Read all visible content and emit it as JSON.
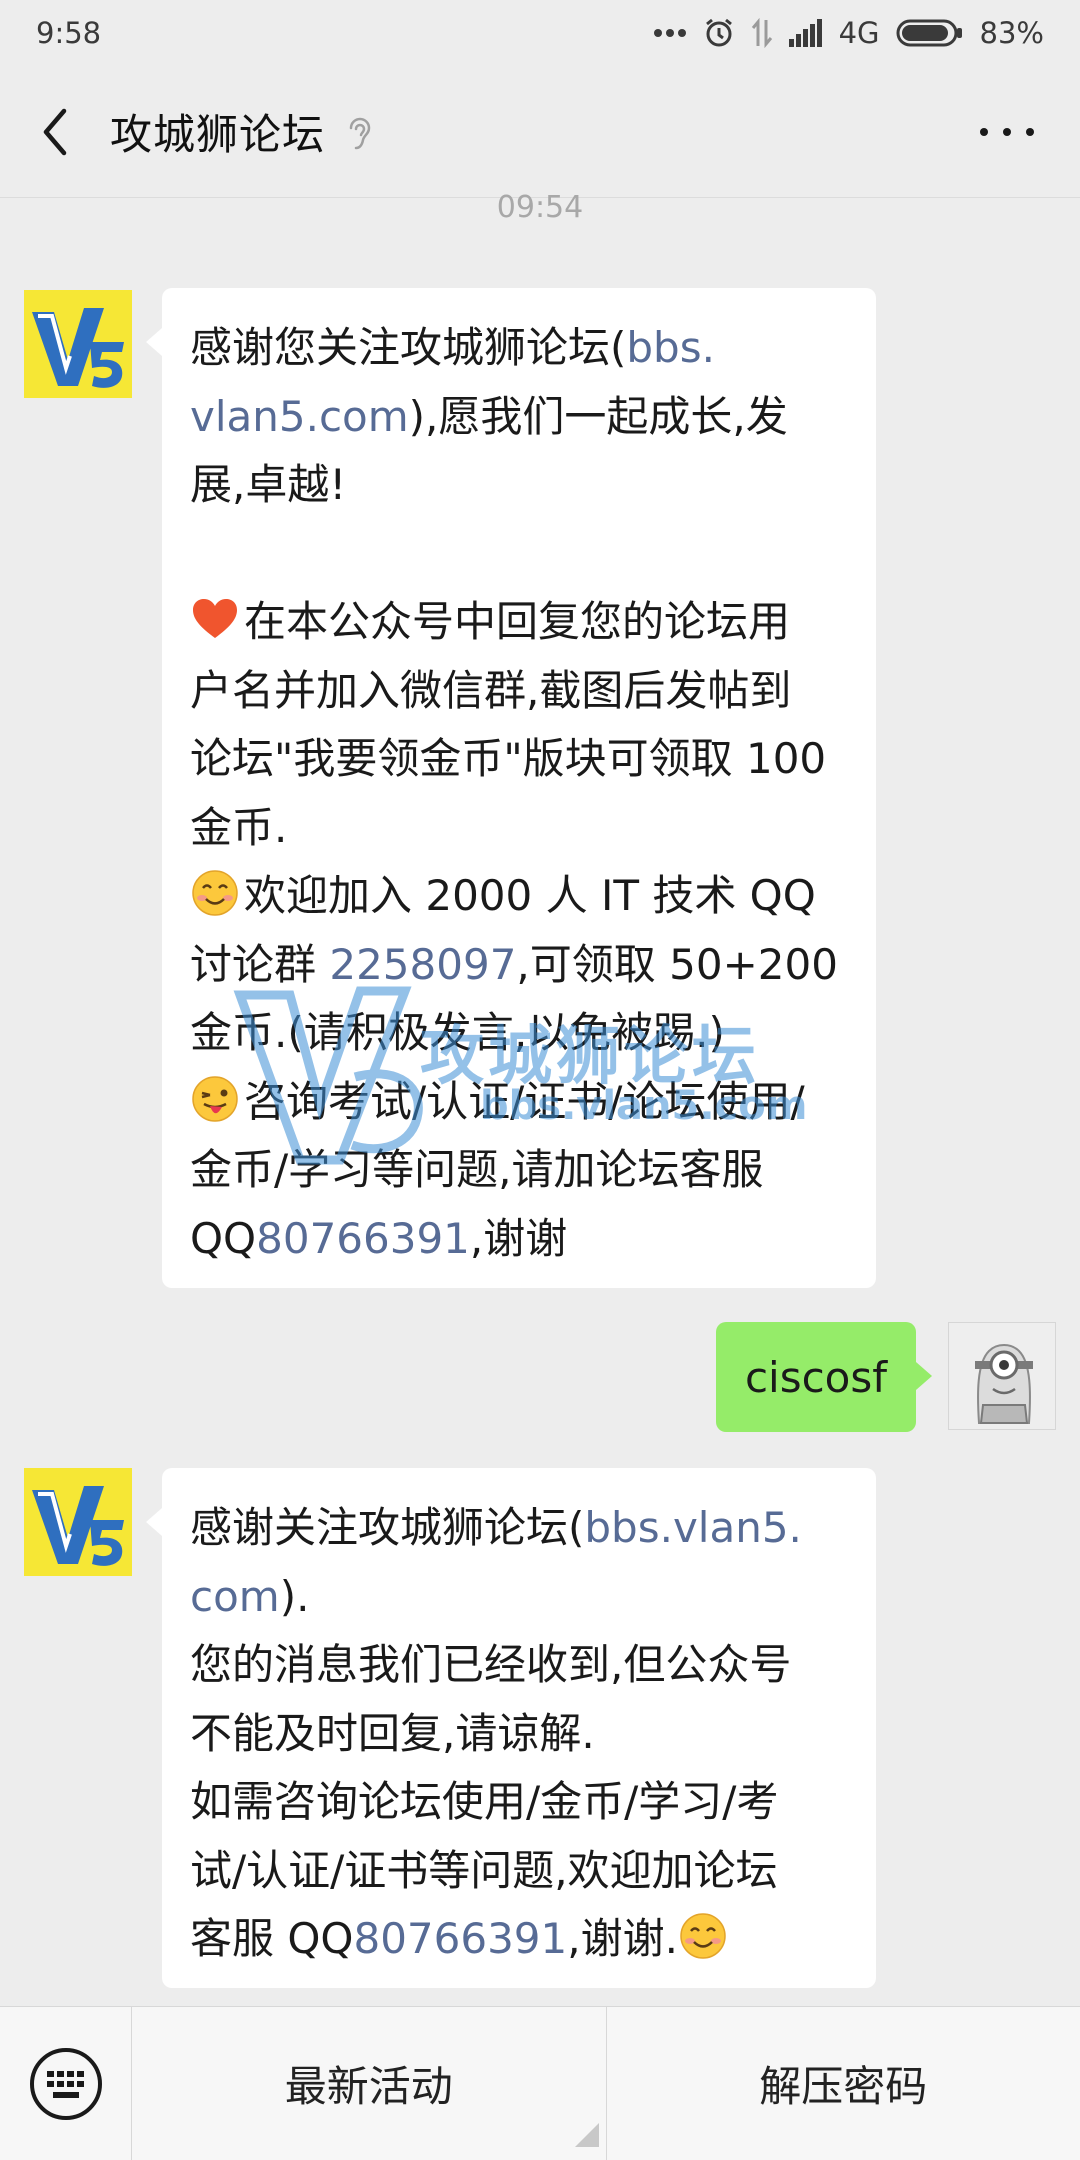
{
  "status_bar": {
    "time": "9:58",
    "network": "4G",
    "battery": "83%"
  },
  "header": {
    "title": "攻城狮论坛"
  },
  "chat": {
    "timestamp": "09:54",
    "messages": [
      {
        "from": "account",
        "lines": [
          [
            "感谢您关注攻城狮论坛(",
            "bbs."
          ],
          [
            "vlan5.com",
            "),愿我们一起成长,发"
          ],
          [
            "展,卓越!"
          ],
          [],
          [
            "在本公众号中回复您的论坛用"
          ],
          [
            "户名并加入微信群,截图后发帖到"
          ],
          [
            "论坛\"我要领金币\"版块可领取 100"
          ],
          [
            "金币."
          ],
          [
            "欢迎加入 2000 人 IT 技术 QQ"
          ],
          [
            "讨论群 ",
            "2258097",
            ",可领取 50+200"
          ],
          [
            "金币.(请积极发言,以免被踢.)"
          ],
          [
            "咨询考试/认证/证书/论坛使用/"
          ],
          [
            "金币/学习等问题,请加论坛客服"
          ],
          [
            "QQ",
            "80766391",
            ",谢谢"
          ]
        ]
      },
      {
        "from": "me",
        "text": "ciscosf"
      },
      {
        "from": "account",
        "lines": [
          [
            "感谢关注攻城狮论坛(",
            "bbs.vlan5."
          ],
          [
            "com",
            ")."
          ],
          [
            "您的消息我们已经收到,但公众号"
          ],
          [
            "不能及时回复,请谅解."
          ],
          [
            "如需咨询论坛使用/金币/学习/考"
          ],
          [
            "试/认证/证书等问题,欢迎加论坛"
          ],
          [
            "客服 QQ",
            "80766391",
            ",谢谢."
          ]
        ]
      }
    ]
  },
  "watermark": {
    "title": "攻城狮论坛",
    "url": "bbs.vlan5.com"
  },
  "bottom_menu": {
    "items": [
      "最新活动",
      "解压密码"
    ]
  },
  "colors": {
    "background": "#ededed",
    "incoming_bubble": "#ffffff",
    "outgoing_bubble": "#95ec69",
    "link": "#576b95",
    "avatar_brand": "#f6e735"
  }
}
